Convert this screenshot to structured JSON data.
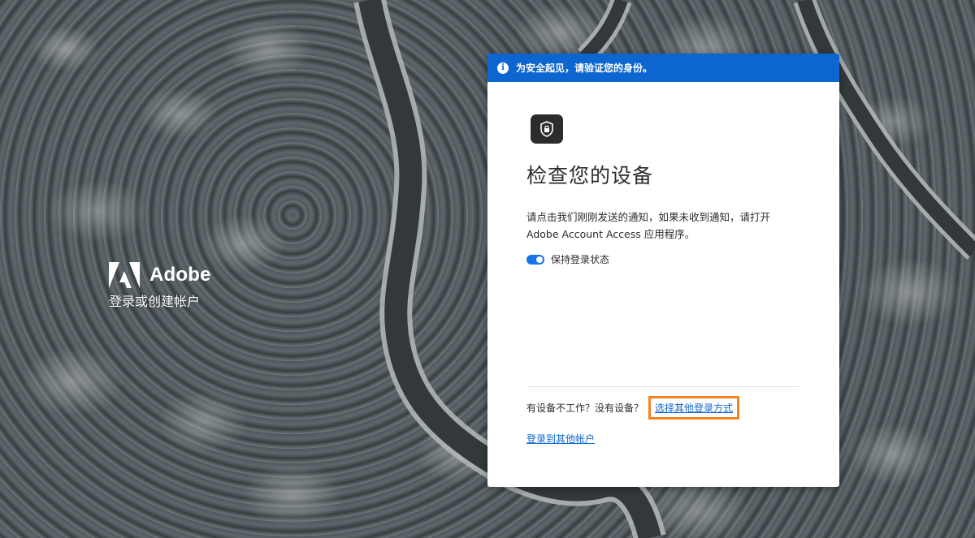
{
  "brand": {
    "name": "Adobe",
    "tagline": "登录或创建帐户",
    "logo_icon": "adobe-logo-icon"
  },
  "banner": {
    "icon": "info-icon",
    "text": "为安全起见，请验证您的身份。",
    "color": "#0d66d0"
  },
  "dialog": {
    "device_icon": "device-lock-icon",
    "title": "检查您的设备",
    "description": "请点击我们刚刚发送的通知，如果未收到通知，请打开 Adobe Account Access 应用程序。",
    "keep_signed_in": {
      "label": "保持登录状态",
      "checked": true
    },
    "trouble_text": "有设备不工作？没有设备？",
    "alt_method_link": "选择其他登录方式",
    "other_account_link": "登录到其他帐户"
  },
  "colors": {
    "accent": "#1473e6",
    "link": "#0d66d0",
    "highlight": "#f58220"
  }
}
